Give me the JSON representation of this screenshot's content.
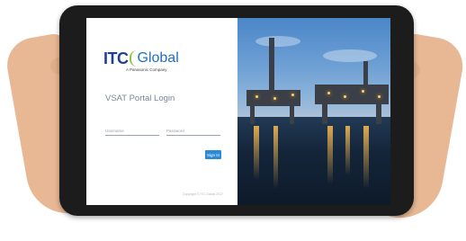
{
  "logo": {
    "brand_primary": "ITC",
    "brand_secondary": "Global",
    "tagline": "A Panasonic Company"
  },
  "login": {
    "title": "VSAT Portal Login",
    "username_placeholder": "Username",
    "password_placeholder": "Password",
    "signin_label": "Sign In",
    "copyright": "Copyright © ITC Global 2017"
  },
  "colors": {
    "accent": "#2b8ad6",
    "brand_blue": "#1f3f8f",
    "brand_green": "#8cc63f"
  },
  "photo": {
    "subject": "offshore-oil-rigs-at-dusk"
  }
}
